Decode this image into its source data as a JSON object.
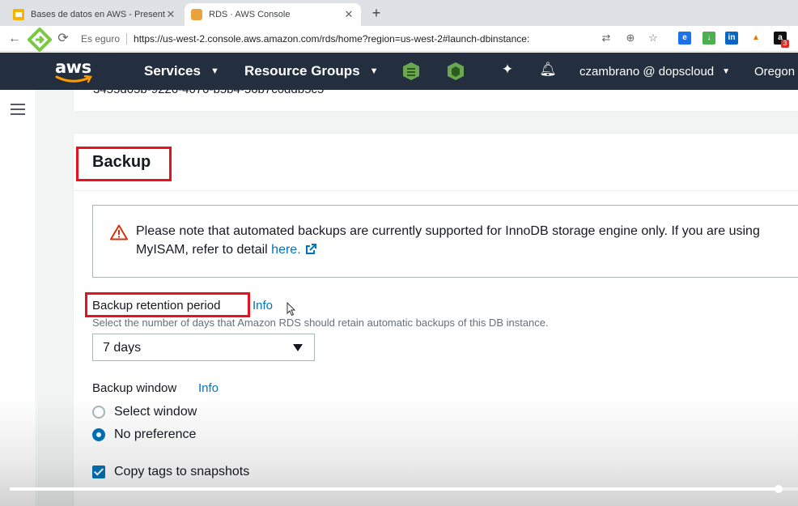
{
  "browser": {
    "tabs": [
      {
        "title": "Bases de datos en AWS - Present",
        "active": false
      },
      {
        "title": "RDS · AWS Console",
        "active": true
      }
    ],
    "omnibox": {
      "security": "Es  eguro",
      "url": "https://us-west-2.console.aws.amazon.com/rds/home?region=us-west-2#launch-dbinstance:"
    },
    "extension_badge": "3"
  },
  "aws_header": {
    "logo": "aws",
    "services": "Services",
    "resource_groups": "Resource Groups",
    "user": "czambrano @ dopscloud",
    "region": "Oregon"
  },
  "page": {
    "section_title": "Backup",
    "alert": {
      "text": "Please note that automated backups are currently supported for InnoDB storage engine only. If you are using MyISAM, refer to detail ",
      "link": "here."
    },
    "retention": {
      "label": "Backup retention period",
      "info": "Info",
      "description": "Select the number of days that Amazon RDS should retain automatic backups of this DB instance.",
      "value": "7 days"
    },
    "backup_window": {
      "label": "Backup window",
      "info": "Info",
      "options": [
        {
          "label": "Select window",
          "selected": false
        },
        {
          "label": "No preference",
          "selected": true
        }
      ]
    },
    "copy_tags": {
      "label": "Copy tags to snapshots",
      "checked": true
    }
  },
  "video": {
    "progress": 0.975
  },
  "colors": {
    "aws_nav": "#232f3e",
    "aws_orange": "#ff9900",
    "link": "#0073bb",
    "highlight": "#e8111d"
  }
}
